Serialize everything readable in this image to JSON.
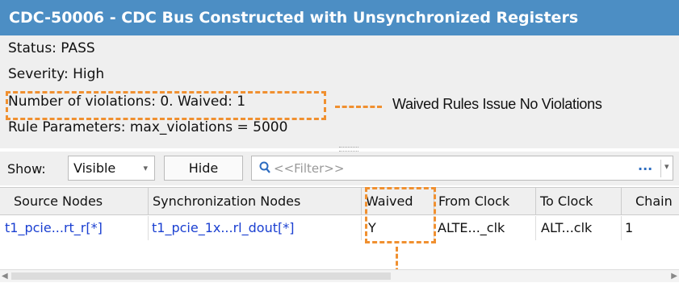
{
  "window": {
    "title": "CDC-50006 - CDC Bus Constructed with Unsynchronized Registers"
  },
  "info": {
    "status": "Status: PASS",
    "severity": "Severity: High",
    "violations": "Number of violations: 0. Waived: 1",
    "parameters": "Rule Parameters: max_violations = 5000"
  },
  "annotation": {
    "callout": "Waived Rules Issue No Violations",
    "color": "#f09030"
  },
  "toolbar": {
    "show_label": "Show:",
    "show_value": "Visible",
    "hide_label": "Hide",
    "filter_placeholder": "<<Filter>>",
    "filter_more": "..."
  },
  "table": {
    "columns": [
      "Source Nodes",
      "Synchronization Nodes",
      "Waived",
      "From Clock",
      "To Clock",
      "Chain"
    ],
    "rows": [
      [
        "t1_pcie...rt_r[*]",
        "t1_pcie_1x...rl_dout[*]",
        "Y",
        "ALTE..._clk",
        "ALT...clk",
        "1"
      ]
    ]
  },
  "colors": {
    "title_bar": "#4c8ec4",
    "link": "#1a3fd1",
    "panel": "#efefef"
  }
}
